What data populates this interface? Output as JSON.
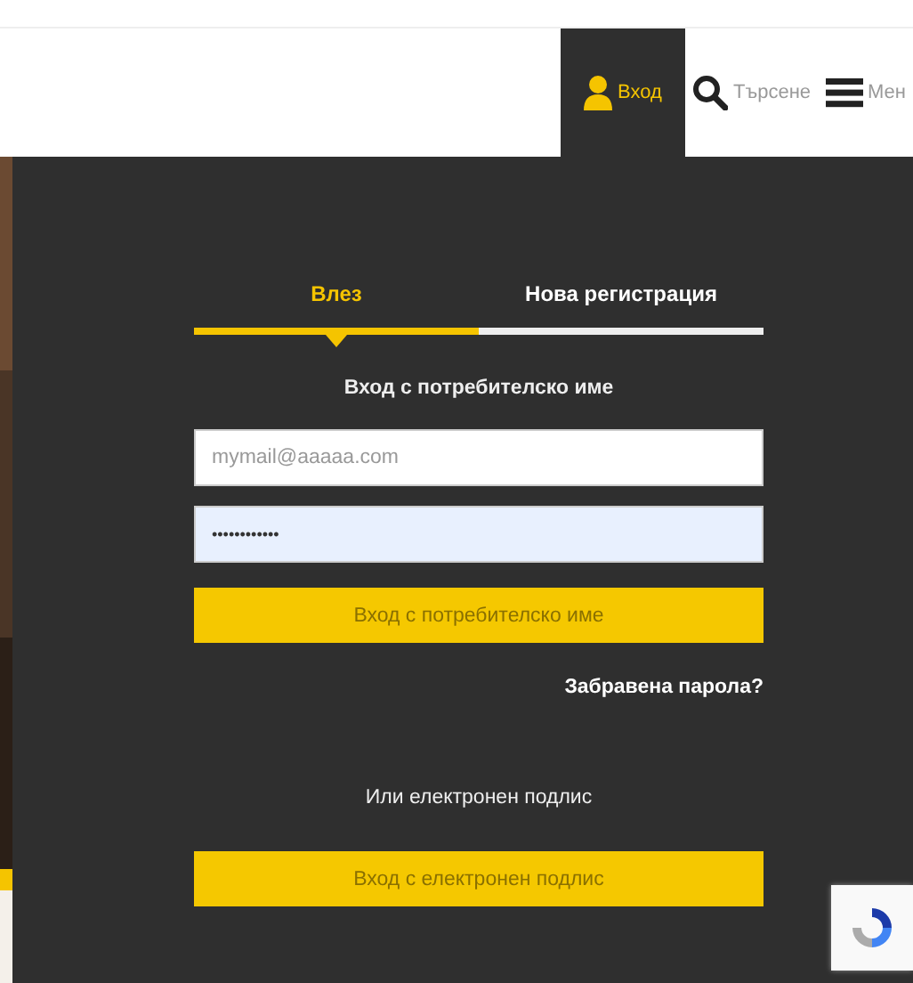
{
  "nav": [
    {
      "kind": "user",
      "label": "Вход",
      "selected": true
    },
    {
      "kind": "search",
      "label": "Търсене",
      "selected": false
    },
    {
      "kind": "menu",
      "label": "Мен",
      "selected": false
    }
  ],
  "tabs": [
    {
      "label": "Влез",
      "selected": true
    },
    {
      "label": "Нова регистрация",
      "selected": false
    }
  ],
  "form": {
    "heading": "Вход с потребителско име",
    "email": {
      "placeholder": "mymail@aaaaa.com"
    },
    "password": {
      "value": "••••••••••••"
    },
    "submit": "Вход с потребителско име",
    "forgot": "Забравена парола?",
    "alt_heading": "Или електронен подлис",
    "alt_submit": "Вход с електронен подлис"
  }
}
